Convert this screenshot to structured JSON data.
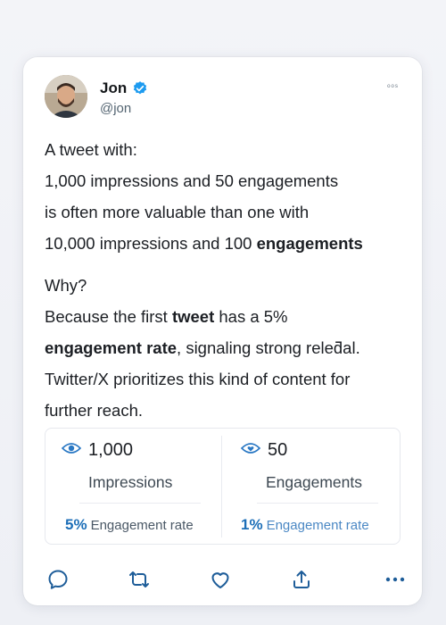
{
  "author": {
    "name": "Jon",
    "handle": "@jon",
    "verified_color": "#1d9bf0"
  },
  "menu_glyph": "ᵒᵒˢ",
  "tweet": {
    "line1": "A tweet with:",
    "line2": "1,000 impressions and 50 engagements",
    "line3": "is often more valuable than one with",
    "line4_prefix": "10,000 impressions and 100 ",
    "line4_bold": "engagements",
    "why": "Why?",
    "p2_a": "Because the first ",
    "p2_b": "tweet",
    "p2_c": " has a 5%",
    "p3_a": "engagement rate",
    "p3_b": ", signaling strong releƌal.",
    "p4": "Twitter/X prioritizes this kind of content for",
    "p5": "further reach."
  },
  "stats": {
    "left": {
      "icon": "eye-icon",
      "value": "1,000",
      "label": "Impressions",
      "rate_pct": "5%",
      "rate_label": "Engagement rate"
    },
    "right": {
      "icon": "heart-eye-icon",
      "value": "50",
      "label": "Engagements",
      "rate_pct": "1%",
      "rate_label": "Engagement rate"
    }
  },
  "actions": [
    "reply-icon",
    "retweet-icon",
    "like-icon",
    "share-icon",
    "more-icon"
  ],
  "colors": {
    "accent": "#1d6fb8",
    "icon_blue": "#2a78c4"
  }
}
